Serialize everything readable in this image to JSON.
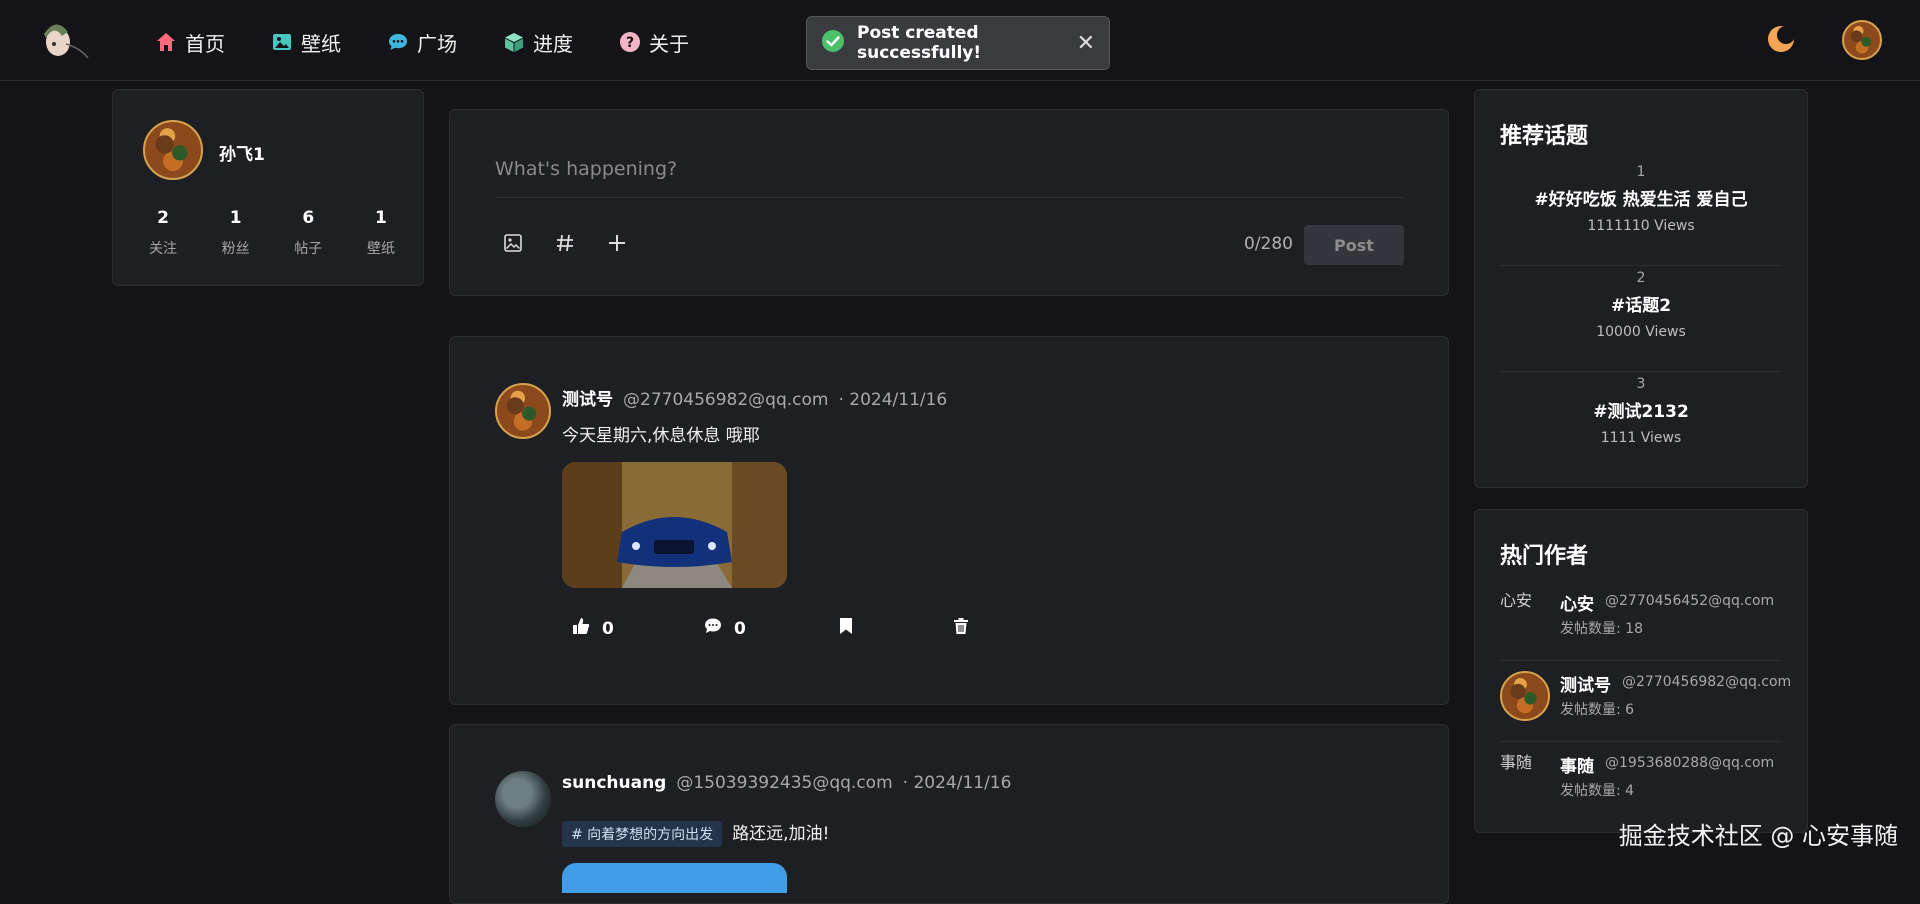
{
  "nav": {
    "items": [
      {
        "label": "首页",
        "icon": "home-icon",
        "color": "#ff6b7d"
      },
      {
        "label": "壁纸",
        "icon": "image-icon",
        "color": "#46c7c0"
      },
      {
        "label": "广场",
        "icon": "chat-icon",
        "color": "#3fb6dd"
      },
      {
        "label": "进度",
        "icon": "cube-icon",
        "color": "#6fd6b0"
      },
      {
        "label": "关于",
        "icon": "question-icon",
        "color": "#f5b4c4"
      }
    ]
  },
  "toast": {
    "text": "Post created successfully!",
    "icon": "check-circle-icon",
    "close": "✕"
  },
  "profile": {
    "name": "孙飞1",
    "stats": [
      {
        "value": "2",
        "label": "关注"
      },
      {
        "value": "1",
        "label": "粉丝"
      },
      {
        "value": "6",
        "label": "帖子"
      },
      {
        "value": "1",
        "label": "壁纸"
      }
    ]
  },
  "composer": {
    "placeholder": "What's happening?",
    "counter": "0/280",
    "post_label": "Post"
  },
  "posts": [
    {
      "author": "测试号",
      "email": "@2770456982@qq.com",
      "date": "· 2024/11/16",
      "text": "今天星期六,休息休息 哦耶",
      "likes": "0",
      "comments": "0"
    },
    {
      "author": "sunchuang",
      "email": "@15039392435@qq.com",
      "date": "· 2024/11/16",
      "tag": "# 向着梦想的方向出发",
      "text": "路还远,加油!"
    }
  ],
  "topics": {
    "title": "推荐话题",
    "items": [
      {
        "rank": "1",
        "name": "#好好吃饭 热爱生活 爱自己",
        "views": "1111110 Views"
      },
      {
        "rank": "2",
        "name": "#话题2",
        "views": "10000 Views"
      },
      {
        "rank": "3",
        "name": "#测试2132",
        "views": "1111 Views"
      }
    ]
  },
  "authors": {
    "title": "热门作者",
    "items": [
      {
        "avatar_alt": "心安",
        "name": "心安",
        "email": "@2770456452@qq.com",
        "count": "发帖数量: 18"
      },
      {
        "avatar_alt": "",
        "name": "测试号",
        "email": "@2770456982@qq.com",
        "count": "发帖数量: 6"
      },
      {
        "avatar_alt": "事随",
        "name": "事随",
        "email": "@1953680288@qq.com",
        "count": "发帖数量: 4"
      }
    ]
  },
  "watermark": "掘金技术社区 @ 心安事随"
}
